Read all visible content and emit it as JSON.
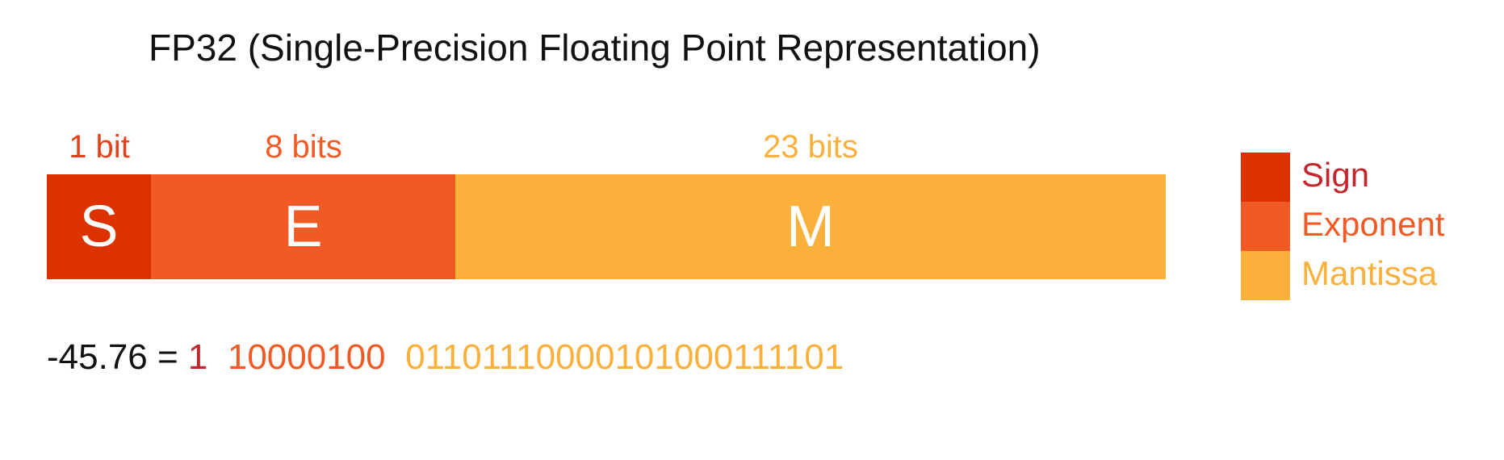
{
  "title": "FP32 (Single-Precision Floating Point Representation)",
  "colors": {
    "sign_block": "#DC3200",
    "exponent_block": "#F15A24",
    "mantissa_block": "#FAB03B",
    "sign_text": "#C1272D",
    "exponent_text": "#F15A24",
    "mantissa_text": "#FAB03B",
    "sign_bits_label": "#E4421A",
    "text": "#111111"
  },
  "fields": [
    {
      "name": "sign",
      "bits_label": "1 bit",
      "letter": "S",
      "bit_count": 1
    },
    {
      "name": "exponent",
      "bits_label": "8 bits",
      "letter": "E",
      "bit_count": 8
    },
    {
      "name": "mantissa",
      "bits_label": "23 bits",
      "letter": "M",
      "bit_count": 23
    }
  ],
  "legend": [
    {
      "label": "Sign"
    },
    {
      "label": "Exponent"
    },
    {
      "label": "Mantissa"
    }
  ],
  "example": {
    "value": "-45.76",
    "equals": " = ",
    "sign": "1",
    "exponent": "10000100",
    "mantissa": "01101110000101000111101"
  }
}
